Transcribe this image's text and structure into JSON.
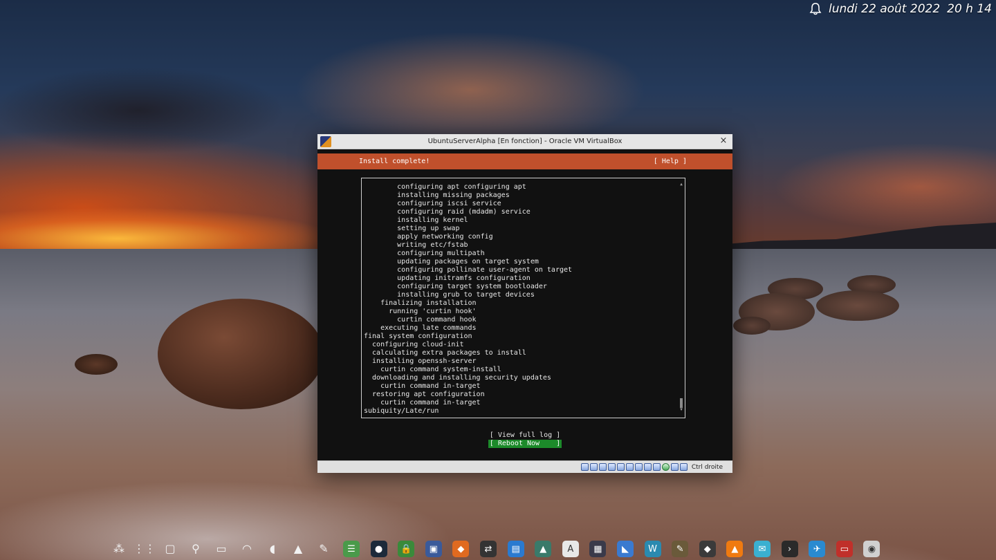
{
  "topbar": {
    "notification_icon": "bell-icon",
    "date": "lundi 22 août 2022",
    "time": "20 h 14"
  },
  "vbox_window": {
    "title": "UbuntuServerAlpha [En fonction] - Oracle VM VirtualBox",
    "close_label": "×",
    "installer": {
      "header_title": "Install complete!",
      "help_label": "[ Help ]",
      "log_lines": [
        "        configuring apt configuring apt",
        "        installing missing packages",
        "        configuring iscsi service",
        "        configuring raid (mdadm) service",
        "        installing kernel",
        "        setting up swap",
        "        apply networking config",
        "        writing etc/fstab",
        "        configuring multipath",
        "        updating packages on target system",
        "        configuring pollinate user-agent on target",
        "        updating initramfs configuration",
        "        configuring target system bootloader",
        "        installing grub to target devices",
        "    finalizing installation",
        "      running 'curtin hook'",
        "        curtin command hook",
        "    executing late commands",
        "final system configuration",
        "  configuring cloud-init",
        "  calculating extra packages to install",
        "  installing openssh-server",
        "    curtin command system-install",
        "  downloading and installing security updates",
        "    curtin command in-target",
        "  restoring apt configuration",
        "    curtin command in-target",
        "subiquity/Late/run"
      ],
      "view_log_label": "[ View full log ]",
      "reboot_label": "[ Reboot Now    ]"
    },
    "statusbar": {
      "host_key_label": "Ctrl droite",
      "icons": [
        "hard-disk-icon",
        "optical-drive-icon",
        "audio-icon",
        "network-icon",
        "usb-icon",
        "shared-folder-icon",
        "display-icon",
        "video-capture-icon",
        "recording-icon",
        "virtualization-icon",
        "cpu-icon",
        "mouse-integration-icon"
      ]
    }
  },
  "dock": {
    "tray_icons": [
      "network-share-icon",
      "app-grid-icon",
      "window-icon",
      "bulb-icon",
      "battery-icon",
      "wifi-icon",
      "volume-icon",
      "arrow-up-icon",
      "pen-icon",
      "circle-icon"
    ],
    "apps": [
      {
        "name": "notes-app-icon",
        "color": "#4a9a4a",
        "glyph": "☰"
      },
      {
        "name": "globe-app-icon",
        "color": "#1c2a3a",
        "glyph": "●"
      },
      {
        "name": "package-lock-icon",
        "color": "#3a8a3a",
        "glyph": "🔒"
      },
      {
        "name": "virtualbox-icon",
        "color": "#3a5a9a",
        "glyph": "▣"
      },
      {
        "name": "software-store-icon",
        "color": "#e06a20",
        "glyph": "◆"
      },
      {
        "name": "terminal-switch-icon",
        "color": "#333333",
        "glyph": "⇄"
      },
      {
        "name": "toolbox-icon",
        "color": "#2a7ad0",
        "glyph": "▤"
      },
      {
        "name": "image-viewer-icon",
        "color": "#3a7a6a",
        "glyph": "▲"
      },
      {
        "name": "font-viewer-icon",
        "color": "#e8e8e8",
        "glyph": "A"
      },
      {
        "name": "calculator-icon",
        "color": "#3a3a4a",
        "glyph": "▦"
      },
      {
        "name": "android-studio-icon",
        "color": "#3a7ad0",
        "glyph": "◣"
      },
      {
        "name": "monitor-app-icon",
        "color": "#2a8ab0",
        "glyph": "W"
      },
      {
        "name": "gimp-icon",
        "color": "#6a5a3a",
        "glyph": "✎"
      },
      {
        "name": "inkscape-icon",
        "color": "#3a3a3a",
        "glyph": "◆"
      },
      {
        "name": "vlc-icon",
        "color": "#f07a10",
        "glyph": "▲"
      },
      {
        "name": "mail-icon",
        "color": "#3ab0d0",
        "glyph": "✉"
      },
      {
        "name": "terminal-icon",
        "color": "#2a2a2a",
        "glyph": "›"
      },
      {
        "name": "bird-app-icon",
        "color": "#2a8ad0",
        "glyph": "✈"
      },
      {
        "name": "files-app-icon",
        "color": "#c0302a",
        "glyph": "▭"
      },
      {
        "name": "chrome-icon",
        "color": "#d0d0d0",
        "glyph": "◉"
      }
    ]
  }
}
